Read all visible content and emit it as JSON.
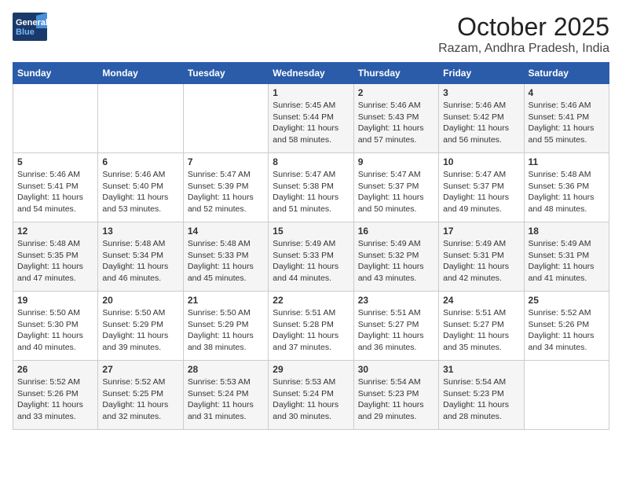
{
  "logo": {
    "line1": "General",
    "line2": "Blue"
  },
  "title": "October 2025",
  "location": "Razam, Andhra Pradesh, India",
  "days_of_week": [
    "Sunday",
    "Monday",
    "Tuesday",
    "Wednesday",
    "Thursday",
    "Friday",
    "Saturday"
  ],
  "weeks": [
    [
      {
        "num": "",
        "info": ""
      },
      {
        "num": "",
        "info": ""
      },
      {
        "num": "",
        "info": ""
      },
      {
        "num": "1",
        "info": "Sunrise: 5:45 AM\nSunset: 5:44 PM\nDaylight: 11 hours\nand 58 minutes."
      },
      {
        "num": "2",
        "info": "Sunrise: 5:46 AM\nSunset: 5:43 PM\nDaylight: 11 hours\nand 57 minutes."
      },
      {
        "num": "3",
        "info": "Sunrise: 5:46 AM\nSunset: 5:42 PM\nDaylight: 11 hours\nand 56 minutes."
      },
      {
        "num": "4",
        "info": "Sunrise: 5:46 AM\nSunset: 5:41 PM\nDaylight: 11 hours\nand 55 minutes."
      }
    ],
    [
      {
        "num": "5",
        "info": "Sunrise: 5:46 AM\nSunset: 5:41 PM\nDaylight: 11 hours\nand 54 minutes."
      },
      {
        "num": "6",
        "info": "Sunrise: 5:46 AM\nSunset: 5:40 PM\nDaylight: 11 hours\nand 53 minutes."
      },
      {
        "num": "7",
        "info": "Sunrise: 5:47 AM\nSunset: 5:39 PM\nDaylight: 11 hours\nand 52 minutes."
      },
      {
        "num": "8",
        "info": "Sunrise: 5:47 AM\nSunset: 5:38 PM\nDaylight: 11 hours\nand 51 minutes."
      },
      {
        "num": "9",
        "info": "Sunrise: 5:47 AM\nSunset: 5:37 PM\nDaylight: 11 hours\nand 50 minutes."
      },
      {
        "num": "10",
        "info": "Sunrise: 5:47 AM\nSunset: 5:37 PM\nDaylight: 11 hours\nand 49 minutes."
      },
      {
        "num": "11",
        "info": "Sunrise: 5:48 AM\nSunset: 5:36 PM\nDaylight: 11 hours\nand 48 minutes."
      }
    ],
    [
      {
        "num": "12",
        "info": "Sunrise: 5:48 AM\nSunset: 5:35 PM\nDaylight: 11 hours\nand 47 minutes."
      },
      {
        "num": "13",
        "info": "Sunrise: 5:48 AM\nSunset: 5:34 PM\nDaylight: 11 hours\nand 46 minutes."
      },
      {
        "num": "14",
        "info": "Sunrise: 5:48 AM\nSunset: 5:33 PM\nDaylight: 11 hours\nand 45 minutes."
      },
      {
        "num": "15",
        "info": "Sunrise: 5:49 AM\nSunset: 5:33 PM\nDaylight: 11 hours\nand 44 minutes."
      },
      {
        "num": "16",
        "info": "Sunrise: 5:49 AM\nSunset: 5:32 PM\nDaylight: 11 hours\nand 43 minutes."
      },
      {
        "num": "17",
        "info": "Sunrise: 5:49 AM\nSunset: 5:31 PM\nDaylight: 11 hours\nand 42 minutes."
      },
      {
        "num": "18",
        "info": "Sunrise: 5:49 AM\nSunset: 5:31 PM\nDaylight: 11 hours\nand 41 minutes."
      }
    ],
    [
      {
        "num": "19",
        "info": "Sunrise: 5:50 AM\nSunset: 5:30 PM\nDaylight: 11 hours\nand 40 minutes."
      },
      {
        "num": "20",
        "info": "Sunrise: 5:50 AM\nSunset: 5:29 PM\nDaylight: 11 hours\nand 39 minutes."
      },
      {
        "num": "21",
        "info": "Sunrise: 5:50 AM\nSunset: 5:29 PM\nDaylight: 11 hours\nand 38 minutes."
      },
      {
        "num": "22",
        "info": "Sunrise: 5:51 AM\nSunset: 5:28 PM\nDaylight: 11 hours\nand 37 minutes."
      },
      {
        "num": "23",
        "info": "Sunrise: 5:51 AM\nSunset: 5:27 PM\nDaylight: 11 hours\nand 36 minutes."
      },
      {
        "num": "24",
        "info": "Sunrise: 5:51 AM\nSunset: 5:27 PM\nDaylight: 11 hours\nand 35 minutes."
      },
      {
        "num": "25",
        "info": "Sunrise: 5:52 AM\nSunset: 5:26 PM\nDaylight: 11 hours\nand 34 minutes."
      }
    ],
    [
      {
        "num": "26",
        "info": "Sunrise: 5:52 AM\nSunset: 5:26 PM\nDaylight: 11 hours\nand 33 minutes."
      },
      {
        "num": "27",
        "info": "Sunrise: 5:52 AM\nSunset: 5:25 PM\nDaylight: 11 hours\nand 32 minutes."
      },
      {
        "num": "28",
        "info": "Sunrise: 5:53 AM\nSunset: 5:24 PM\nDaylight: 11 hours\nand 31 minutes."
      },
      {
        "num": "29",
        "info": "Sunrise: 5:53 AM\nSunset: 5:24 PM\nDaylight: 11 hours\nand 30 minutes."
      },
      {
        "num": "30",
        "info": "Sunrise: 5:54 AM\nSunset: 5:23 PM\nDaylight: 11 hours\nand 29 minutes."
      },
      {
        "num": "31",
        "info": "Sunrise: 5:54 AM\nSunset: 5:23 PM\nDaylight: 11 hours\nand 28 minutes."
      },
      {
        "num": "",
        "info": ""
      }
    ]
  ]
}
